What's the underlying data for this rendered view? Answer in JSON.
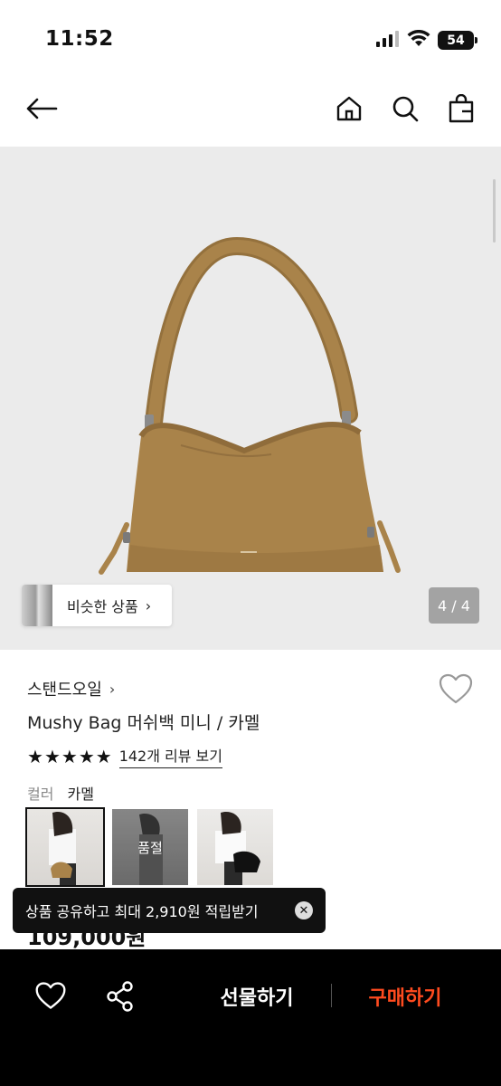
{
  "status_bar": {
    "time": "11:52",
    "battery": "54",
    "icons": [
      "cellular-signal-icon",
      "wifi-icon",
      "battery-icon"
    ]
  },
  "top_nav": {
    "icons": [
      "back-arrow-icon",
      "home-icon",
      "search-icon",
      "shopping-bag-icon"
    ]
  },
  "gallery": {
    "similar_label": "비슷한 상품",
    "counter": "4 / 4",
    "current_page": 4,
    "total_pages": 4
  },
  "product": {
    "brand": "스탠드오일",
    "title": "Mushy Bag 머쉬백 미니 / 카멜",
    "rating_stars": 5,
    "review_link": "142개 리뷰 보기",
    "color_label": "컬러",
    "color_value": "카멜",
    "swatches": [
      {
        "selected": true,
        "status": ""
      },
      {
        "selected": false,
        "status": "품절"
      },
      {
        "selected": false,
        "status": ""
      }
    ],
    "price": "109,000원"
  },
  "toast": {
    "message": "상품 공유하고 최대 2,910원 적립받기",
    "close_icon": "close-circle-icon"
  },
  "bottom_bar": {
    "gift_label": "선물하기",
    "buy_label": "구매하기",
    "buy_color": "#ff4b1f",
    "icons": [
      "heart-outline-icon",
      "share-icon"
    ]
  },
  "colors": {
    "hero_bg": "#ebebeb",
    "bag_camel": "#a9834a",
    "bottom_bar_bg": "#000000"
  }
}
